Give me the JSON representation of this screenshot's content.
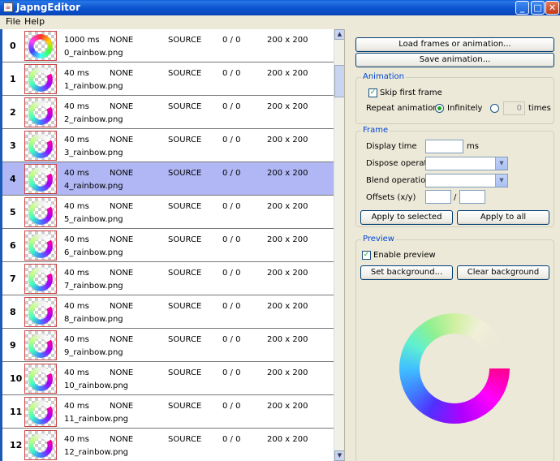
{
  "window": {
    "title": "JapngEditor",
    "icon": "java-app-icon"
  },
  "menu": {
    "file": "File",
    "help": "Help"
  },
  "frames": [
    {
      "index": "0",
      "delay": "1000 ms",
      "dispose": "NONE",
      "blend": "SOURCE",
      "offsets": "0 / 0",
      "size": "200 x 200",
      "file": "0_rainbow.png"
    },
    {
      "index": "1",
      "delay": "40 ms",
      "dispose": "NONE",
      "blend": "SOURCE",
      "offsets": "0 / 0",
      "size": "200 x 200",
      "file": "1_rainbow.png"
    },
    {
      "index": "2",
      "delay": "40 ms",
      "dispose": "NONE",
      "blend": "SOURCE",
      "offsets": "0 / 0",
      "size": "200 x 200",
      "file": "2_rainbow.png"
    },
    {
      "index": "3",
      "delay": "40 ms",
      "dispose": "NONE",
      "blend": "SOURCE",
      "offsets": "0 / 0",
      "size": "200 x 200",
      "file": "3_rainbow.png"
    },
    {
      "index": "4",
      "delay": "40 ms",
      "dispose": "NONE",
      "blend": "SOURCE",
      "offsets": "0 / 0",
      "size": "200 x 200",
      "file": "4_rainbow.png"
    },
    {
      "index": "5",
      "delay": "40 ms",
      "dispose": "NONE",
      "blend": "SOURCE",
      "offsets": "0 / 0",
      "size": "200 x 200",
      "file": "5_rainbow.png"
    },
    {
      "index": "6",
      "delay": "40 ms",
      "dispose": "NONE",
      "blend": "SOURCE",
      "offsets": "0 / 0",
      "size": "200 x 200",
      "file": "6_rainbow.png"
    },
    {
      "index": "7",
      "delay": "40 ms",
      "dispose": "NONE",
      "blend": "SOURCE",
      "offsets": "0 / 0",
      "size": "200 x 200",
      "file": "7_rainbow.png"
    },
    {
      "index": "8",
      "delay": "40 ms",
      "dispose": "NONE",
      "blend": "SOURCE",
      "offsets": "0 / 0",
      "size": "200 x 200",
      "file": "8_rainbow.png"
    },
    {
      "index": "9",
      "delay": "40 ms",
      "dispose": "NONE",
      "blend": "SOURCE",
      "offsets": "0 / 0",
      "size": "200 x 200",
      "file": "9_rainbow.png"
    },
    {
      "index": "10",
      "delay": "40 ms",
      "dispose": "NONE",
      "blend": "SOURCE",
      "offsets": "0 / 0",
      "size": "200 x 200",
      "file": "10_rainbow.png"
    },
    {
      "index": "11",
      "delay": "40 ms",
      "dispose": "NONE",
      "blend": "SOURCE",
      "offsets": "0 / 0",
      "size": "200 x 200",
      "file": "11_rainbow.png"
    },
    {
      "index": "12",
      "delay": "40 ms",
      "dispose": "NONE",
      "blend": "SOURCE",
      "offsets": "0 / 0",
      "size": "200 x 200",
      "file": "12_rainbow.png"
    }
  ],
  "selected_frame": 4,
  "panel": {
    "load_button": "Load frames or animation...",
    "save_button": "Save animation...",
    "animation": {
      "title": "Animation",
      "skip_first_frame": "Skip first frame",
      "skip_first_frame_checked": true,
      "repeat_label": "Repeat animation",
      "infinitely": "Infinitely",
      "infinitely_selected": true,
      "repeat_count": "0",
      "times": "times"
    },
    "frame": {
      "title": "Frame",
      "display_time": "Display time",
      "display_time_value": "",
      "ms": "ms",
      "dispose_operation": "Dispose operation",
      "blend_operation": "Blend operation",
      "offsets": "Offsets (x/y)",
      "offsets_sep": "/",
      "apply_selected": "Apply to selected",
      "apply_all": "Apply to all"
    },
    "preview": {
      "title": "Preview",
      "enable_preview": "Enable preview",
      "enable_preview_checked": true,
      "set_background": "Set background...",
      "clear_background": "Clear background"
    }
  },
  "colors": {
    "selection": "#b0b7f4",
    "group_title": "#0046d5",
    "titlebar": "#0a55d0"
  }
}
